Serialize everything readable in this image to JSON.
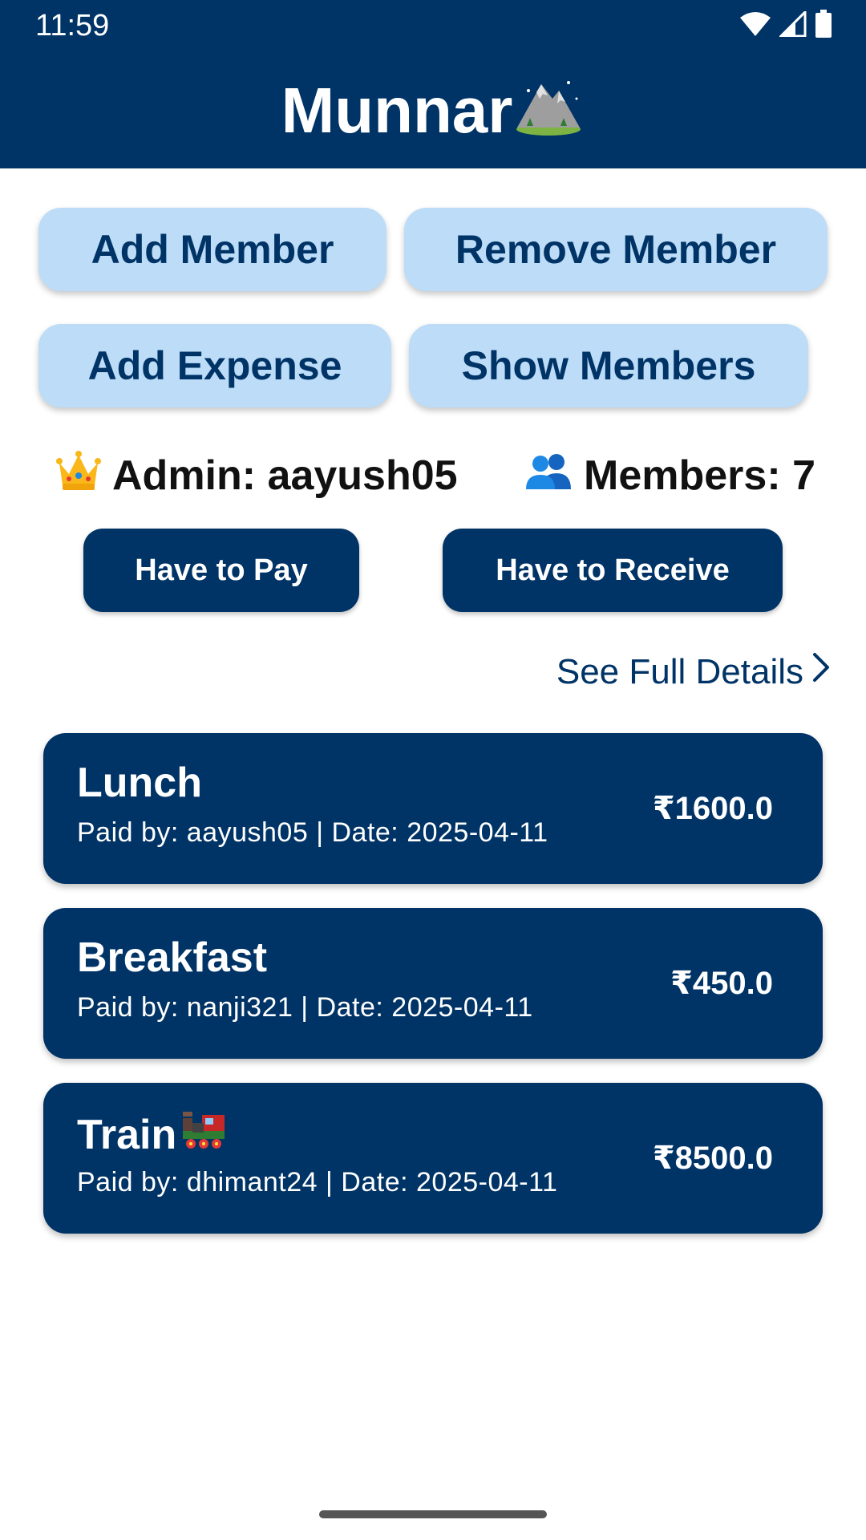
{
  "status_bar": {
    "time": "11:59",
    "icons": [
      "wifi-icon",
      "signal-icon",
      "battery-icon"
    ]
  },
  "header": {
    "title": "Munnar",
    "title_icon": "mountain-icon",
    "background_color": "#003366"
  },
  "actions": {
    "add_member": "Add Member",
    "remove_member": "Remove Member",
    "add_expense": "Add Expense",
    "show_members": "Show Members"
  },
  "group_info": {
    "admin_icon": "crown-icon",
    "admin_text": "Admin: aayush05",
    "members_icon": "people-icon",
    "members_text": "Members: 7"
  },
  "balance_buttons": {
    "have_to_pay": "Have to Pay",
    "have_to_receive": "Have to Receive"
  },
  "details_link": {
    "label": "See Full Details",
    "icon": "chevron-right-icon"
  },
  "expenses": [
    {
      "title": "Lunch",
      "title_icon": "",
      "subtitle": "Paid by: aayush05 | Date: 2025-04-11",
      "amount": "₹1600.0"
    },
    {
      "title": "Breakfast",
      "title_icon": "",
      "subtitle": "Paid by: nanji321 | Date: 2025-04-11",
      "amount": "₹450.0"
    },
    {
      "title": "Train",
      "title_icon": "locomotive-icon",
      "subtitle": "Paid by: dhimant24 | Date: 2025-04-11",
      "amount": "₹8500.0"
    }
  ],
  "colors": {
    "primary": "#003366",
    "light_button": "#bcdcf7"
  }
}
